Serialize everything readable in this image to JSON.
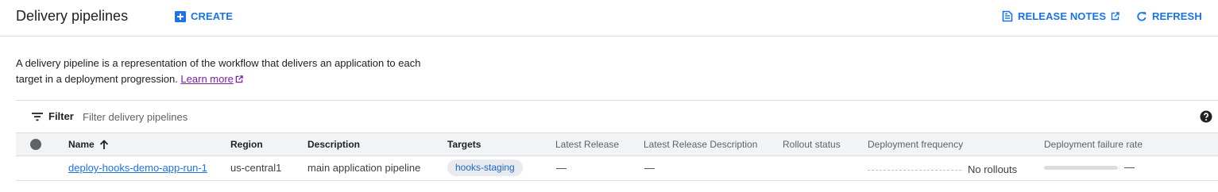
{
  "header": {
    "title": "Delivery pipelines",
    "create_label": "CREATE",
    "release_notes_label": "RELEASE NOTES",
    "refresh_label": "REFRESH",
    "accent_color": "#1a73e8"
  },
  "intro": {
    "text": "A delivery pipeline is a representation of the workflow that delivers an application to each target in a deployment progression.",
    "learn_more": "Learn more"
  },
  "filter": {
    "label": "Filter",
    "placeholder": "Filter delivery pipelines"
  },
  "table": {
    "columns": {
      "name": "Name",
      "region": "Region",
      "description": "Description",
      "targets": "Targets",
      "latest_release": "Latest Release",
      "latest_release_description": "Latest Release Description",
      "rollout_status": "Rollout status",
      "deployment_frequency": "Deployment frequency",
      "deployment_failure_rate": "Deployment failure rate"
    },
    "sort": {
      "column": "Name",
      "direction": "ascending",
      "icon": "arrow-up-icon"
    },
    "rows": [
      {
        "name": "deploy-hooks-demo-app-run-1",
        "region": "us-central1",
        "description": "main application pipeline",
        "targets": "hooks-staging",
        "latest_release": "—",
        "latest_release_description": "—",
        "deployment_frequency": "No rollouts",
        "deployment_failure_rate": "—"
      }
    ]
  }
}
